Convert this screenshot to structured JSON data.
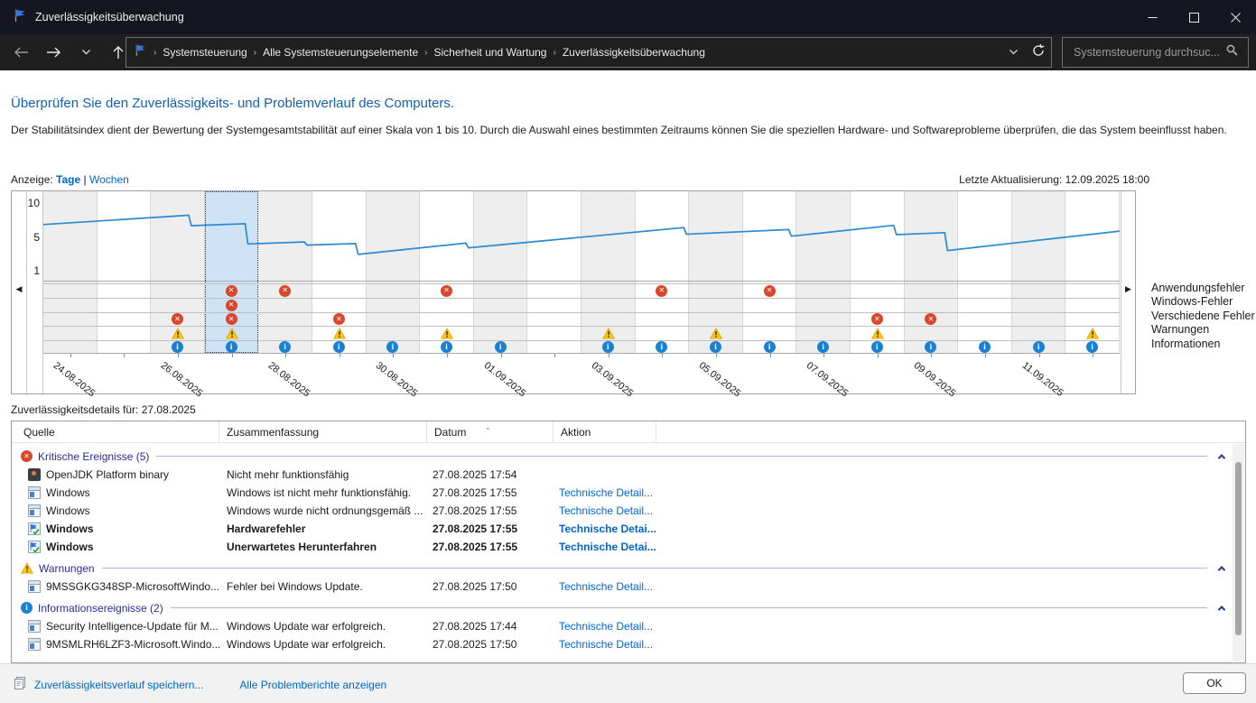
{
  "window": {
    "title": "Zuverlässigkeitsüberwachung"
  },
  "nav": {
    "breadcrumb": [
      "Systemsteuerung",
      "Alle Systemsteuerungselemente",
      "Sicherheit und Wartung",
      "Zuverlässigkeitsüberwachung"
    ],
    "search_placeholder": "Systemsteuerung durchsuc..."
  },
  "header": {
    "title": "Überprüfen Sie den Zuverlässigkeits- und Problemverlauf des Computers.",
    "description": "Der Stabilitätsindex dient der Bewertung der Systemgesamtstabilität auf einer Skala von 1 bis 10. Durch die Auswahl eines bestimmten Zeitraums können Sie die speziellen Hardware- und Softwareprobleme überprüfen, die das System beeinflusst haben."
  },
  "viewbar": {
    "label": "Anzeige:",
    "days_link": "Tage",
    "separator": "|",
    "weeks_link": "Wochen",
    "last_update": "Letzte Aktualisierung: 12.09.2025 18:00"
  },
  "chart_data": {
    "type": "line",
    "ylim": [
      0,
      10
    ],
    "yticks": [
      10,
      5,
      1
    ],
    "legend_rows": [
      "Anwendungsfehler",
      "Windows-Fehler",
      "Verschiedene Fehler",
      "Warnungen",
      "Informationen"
    ],
    "event_row_keys": [
      "app",
      "win",
      "misc",
      "warn",
      "info"
    ],
    "selected_date": "27.08.2025",
    "days": [
      {
        "date": "24.08.2025",
        "label": true,
        "events": []
      },
      {
        "date": "25.08.2025",
        "label": false,
        "events": []
      },
      {
        "date": "26.08.2025",
        "label": true,
        "events": [
          "misc",
          "warn",
          "info"
        ]
      },
      {
        "date": "27.08.2025",
        "label": false,
        "selected": true,
        "events": [
          "app",
          "win",
          "misc",
          "warn",
          "info"
        ]
      },
      {
        "date": "28.08.2025",
        "label": true,
        "events": [
          "app",
          "info"
        ]
      },
      {
        "date": "29.08.2025",
        "label": false,
        "events": [
          "misc",
          "warn",
          "info"
        ]
      },
      {
        "date": "30.08.2025",
        "label": true,
        "events": [
          "info"
        ]
      },
      {
        "date": "31.08.2025",
        "label": false,
        "events": [
          "app",
          "warn",
          "info"
        ]
      },
      {
        "date": "01.09.2025",
        "label": true,
        "events": [
          "info"
        ]
      },
      {
        "date": "02.09.2025",
        "label": false,
        "events": []
      },
      {
        "date": "03.09.2025",
        "label": true,
        "events": [
          "warn",
          "info"
        ]
      },
      {
        "date": "04.09.2025",
        "label": false,
        "events": [
          "app",
          "info"
        ]
      },
      {
        "date": "05.09.2025",
        "label": true,
        "events": [
          "warn",
          "info"
        ]
      },
      {
        "date": "06.09.2025",
        "label": false,
        "events": [
          "app",
          "info"
        ]
      },
      {
        "date": "07.09.2025",
        "label": true,
        "events": [
          "info"
        ]
      },
      {
        "date": "08.09.2025",
        "label": false,
        "events": [
          "misc",
          "warn",
          "info"
        ]
      },
      {
        "date": "09.09.2025",
        "label": true,
        "events": [
          "misc",
          "info"
        ]
      },
      {
        "date": "10.09.2025",
        "label": false,
        "events": [
          "info"
        ]
      },
      {
        "date": "11.09.2025",
        "label": true,
        "events": [
          "info"
        ]
      },
      {
        "date": "12.09.2025",
        "label": false,
        "events": [
          "warn",
          "info"
        ]
      }
    ],
    "stability_line_day_value": [
      [
        0,
        7.0
      ],
      [
        2.7,
        8.2
      ],
      [
        2.75,
        6.85
      ],
      [
        3.75,
        7.1
      ],
      [
        3.8,
        4.5
      ],
      [
        4.85,
        4.75
      ],
      [
        4.9,
        4.35
      ],
      [
        5.8,
        4.55
      ],
      [
        5.85,
        3.15
      ],
      [
        7.85,
        4.6
      ],
      [
        7.9,
        4.0
      ],
      [
        11.9,
        6.6
      ],
      [
        11.95,
        5.75
      ],
      [
        13.85,
        6.35
      ],
      [
        13.9,
        5.5
      ],
      [
        15.8,
        6.9
      ],
      [
        15.85,
        5.7
      ],
      [
        16.75,
        5.95
      ],
      [
        16.8,
        3.65
      ],
      [
        20,
        6.15
      ]
    ],
    "line_color": "#2b8ad1"
  },
  "details": {
    "title": "Zuverlässigkeitsdetails für: 27.08.2025",
    "columns": [
      "Quelle",
      "Zusammenfassung",
      "Datum",
      "Aktion"
    ],
    "groups": [
      {
        "icon": "critical-group-icon",
        "kind": "error",
        "label": "Kritische Ereignisse (5)",
        "rows": [
          {
            "icon": "openjdk",
            "source": "OpenJDK Platform binary",
            "summary": "Nicht mehr funktionsfähig",
            "date": "27.08.2025 17:54",
            "action": ""
          },
          {
            "icon": "window",
            "source": "Windows",
            "summary": "Windows ist nicht mehr funktionsfähig.",
            "date": "27.08.2025 17:55",
            "action": "Technische Detail..."
          },
          {
            "icon": "window",
            "source": "Windows",
            "summary": "Windows wurde nicht ordnungsgemäß ...",
            "date": "27.08.2025 17:55",
            "action": "Technische Detail..."
          },
          {
            "icon": "flagcheck",
            "source": "Windows",
            "summary": "Hardwarefehler",
            "date": "27.08.2025 17:55",
            "action": "Technische Detai...",
            "bold": true
          },
          {
            "icon": "flagcheck",
            "source": "Windows",
            "summary": "Unerwartetes Herunterfahren",
            "date": "27.08.2025 17:55",
            "action": "Technische Detai...",
            "bold": true
          }
        ]
      },
      {
        "icon": "warning-group-icon",
        "kind": "warn",
        "label": "Warnungen",
        "rows": [
          {
            "icon": "window",
            "source": "9MSSGKG348SP-MicrosoftWindo...",
            "summary": "Fehler bei Windows Update.",
            "date": "27.08.2025 17:50",
            "action": "Technische Detail..."
          }
        ]
      },
      {
        "icon": "info-group-icon",
        "kind": "info",
        "label": "Informationsereignisse (2)",
        "rows": [
          {
            "icon": "window",
            "source": "Security Intelligence-Update für M...",
            "summary": "Windows Update war erfolgreich.",
            "date": "27.08.2025 17:44",
            "action": "Technische Detail..."
          },
          {
            "icon": "window",
            "source": "9MSMLRH6LZF3-Microsoft.Windo...",
            "summary": "Windows Update war erfolgreich.",
            "date": "27.08.2025 17:50",
            "action": "Technische Detail..."
          }
        ]
      }
    ]
  },
  "footer": {
    "save_link": "Zuverlässigkeitsverlauf speichern...",
    "reports_link": "Alle Problemberichte anzeigen",
    "ok_label": "OK"
  },
  "colors": {
    "accent_blue": "#1560ac",
    "link_blue": "#0066cc",
    "error_red": "#d8472b",
    "warning_yellow": "#fdc50b",
    "info_blue": "#1a80d1",
    "selected_day": "#cfe3f7",
    "titlebar": "#161620",
    "navbar": "#1f1f1f"
  }
}
